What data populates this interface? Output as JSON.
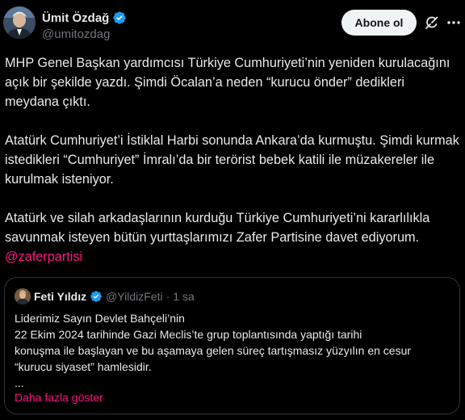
{
  "author": {
    "name": "Ümit Özdağ",
    "handle": "@umitozdag"
  },
  "header": {
    "follow_label": "Abone ol",
    "icons": [
      "verified-badge-icon",
      "grok-icon",
      "more-icon"
    ]
  },
  "tweet": {
    "paragraphs": [
      "MHP Genel Başkan yardımcısı Türkiye Cumhuriyeti’nin yeniden kurulacağını açık bir şekilde yazdı. Şimdi Öcalan’a neden “kurucu önder” dedikleri meydana çıktı.",
      "Atatürk Cumhuriyet’i İstiklal Harbi sonunda Ankara’da kurmuştu. Şimdi kurmak istedikleri “Cumhuriyet” İmralı’da bir terörist bebek katili ile müzakereler ile kurulmak isteniyor.",
      "Atatürk ve silah arkadaşlarının kurduğu Türkiye Cumhuriyeti’ni kararlılıkla savunmak isteyen bütün yurttaşlarımızı Zafer Partisine davet ediyorum."
    ],
    "mention": "@zaferpartisi"
  },
  "quote": {
    "name": "Feti Yıldız",
    "handle": "@YildizFeti",
    "separator": "·",
    "time": "1 sa",
    "lines": [
      "Liderimiz Sayın Devlet Bahçeli’nin",
      "22 Ekim 2024 tarihinde Gazi Meclis’te grup toplantısında yaptığı tarihi",
      "konuşma ile başlayan ve bu aşamaya gelen süreç tartışmasız yüzyılın en cesur",
      "“kurucu siyaset” hamlesidir.",
      "..."
    ],
    "show_more": "Daha fazla göster"
  },
  "colors": {
    "background": "#000000",
    "text": "#e7e9ea",
    "secondary": "#71767b",
    "accent": "#f91880",
    "verified": "#1d9bf0",
    "border": "#2f3336"
  }
}
